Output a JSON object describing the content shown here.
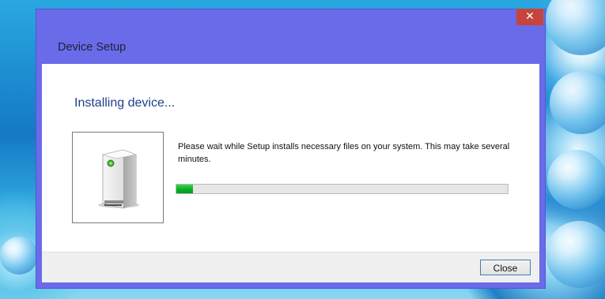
{
  "window": {
    "title": "Device Setup",
    "close_glyph": "✕"
  },
  "content": {
    "heading": "Installing device...",
    "message": "Please wait while Setup installs necessary files on your system. This may take several minutes.",
    "device_icon": "computer-tower-icon",
    "progress_fraction": 0.05
  },
  "footer": {
    "close_label": "Close"
  },
  "colors": {
    "titlebar": "#6a6be8",
    "close_red": "#c7443c",
    "heading_blue": "#1e3f8a",
    "progress_green": "#06b025"
  }
}
